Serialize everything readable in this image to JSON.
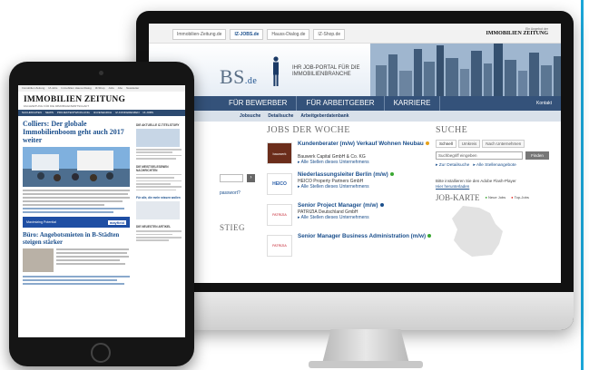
{
  "colors": {
    "nav_blue": "#34527a",
    "link_blue": "#1b4f8c",
    "accent_cyan": "#1ba6d8",
    "ipad_ad_blue": "#1e4ea3"
  },
  "desktop": {
    "top_tabs": [
      "Immobilien-Zeitung.de",
      "IZ-JOBS.de",
      "Hauss-Dialog.de",
      "IZ-Shop.de"
    ],
    "active_tab": "IZ-JOBS.de",
    "sponsor_pre": "Ein Angebot der",
    "sponsor_name": "IMMOBILIEN ZEITUNG",
    "logo_main": "BS",
    "logo_suffix": ".de",
    "tagline_1": "IHR JOB-PORTAL FÜR DIE",
    "tagline_2": "IMMOBILIENBRANCHE",
    "nav": [
      "FÜR BEWERBER",
      "FÜR ARBEITGEBER",
      "KARRIERE"
    ],
    "nav_contact": "Kontakt",
    "subnav": [
      "Jobsuche",
      "Detailsuche",
      "Arbeitgeberdatenbank"
    ],
    "left_partial_link": "passwort?",
    "left_partial_heading": "STIEG",
    "jobs_heading": "JOBS DER WOCHE",
    "jobs": [
      {
        "title": "Kundenberater (m/w) Verkauf Wohnen Neubau",
        "company": "Bauwerk Capital GmbH & Co. KG",
        "link": "Alle Stellen dieses Unternehmens",
        "logo": "bauwerk",
        "logo_color": "#6b2d1b",
        "dot": "#e7a21b"
      },
      {
        "title": "Niederlassungsleiter Berlin (m/w)",
        "company": "HEICO Property Partners GmbH",
        "link": "Alle Stellen dieses Unternehmens",
        "logo": "HEICO",
        "logo_color": "#2a5ea8",
        "dot": "#3aa832"
      },
      {
        "title": "Senior Project Manager (m/w)",
        "company": "PATRIZIA Deutschland GmbH",
        "link": "Alle Stellen dieses Unternehmens",
        "logo": "PATRIZIA",
        "logo_color": "#c4212e",
        "dot": "#1b4f8c"
      },
      {
        "title": "Senior Manager Business Administration (m/w)",
        "company": "",
        "link": "",
        "logo": "PATRIZIA",
        "logo_color": "#c4212e",
        "dot": "#3aa832"
      }
    ],
    "search_heading": "SUCHE",
    "search_tabs": [
      "Schnell",
      "Umkreis",
      "Nach Unternehmen"
    ],
    "search_placeholder": "Suchbegriff eingeben",
    "search_button": "Finden",
    "search_link_1": "Zur Detailsuche",
    "search_link_2": "Alle Stellenangebote",
    "flash_note": "Bitte installieren Sie den Adobe Flash-Player",
    "flash_link": "Hier herunterladen",
    "map_title": "JOB-KARTE",
    "map_legend_1": "Neue Jobs",
    "map_legend_2": "Top-Jobs"
  },
  "tablet": {
    "topnav": [
      "Immobilien Zeitung",
      "IZ-Jobs",
      "Immobilien Hauss-Dialog",
      "IZ-Shop",
      "Jobs",
      "Abo",
      "Newsletter",
      "Probeheft"
    ],
    "masthead_title": "IMMOBILIEN ZEITUNG",
    "masthead_sub": "FACHZEITUNG FÜR DIE IMMOBILIENWIRTSCHAFT",
    "nav": [
      "NACHRICHTEN",
      "NEWS",
      "PROJEKTENTWICKLUNG",
      "IZ-RESEARCH",
      "IZ-KONFERENZEN",
      "IZ-JOBS"
    ],
    "headline_1": "Colliers: Der globale Immobilienboom geht auch 2017 weiter",
    "ad_left": "Maximizing Potential",
    "ad_right": "mayfield",
    "headline_2": "Büro: Angebotsmieten in B-Städten steigen stärker",
    "side_heading_1": "DIE AKTUELLE IZ-TITELSTORY",
    "side_heading_2": "DIE MEISTGELESENEN NACHRICHTEN",
    "side_heading_3": "DIE NEUESTEN ARTIKEL",
    "side_promo": "Für alle, die mehr wissen wollen"
  }
}
